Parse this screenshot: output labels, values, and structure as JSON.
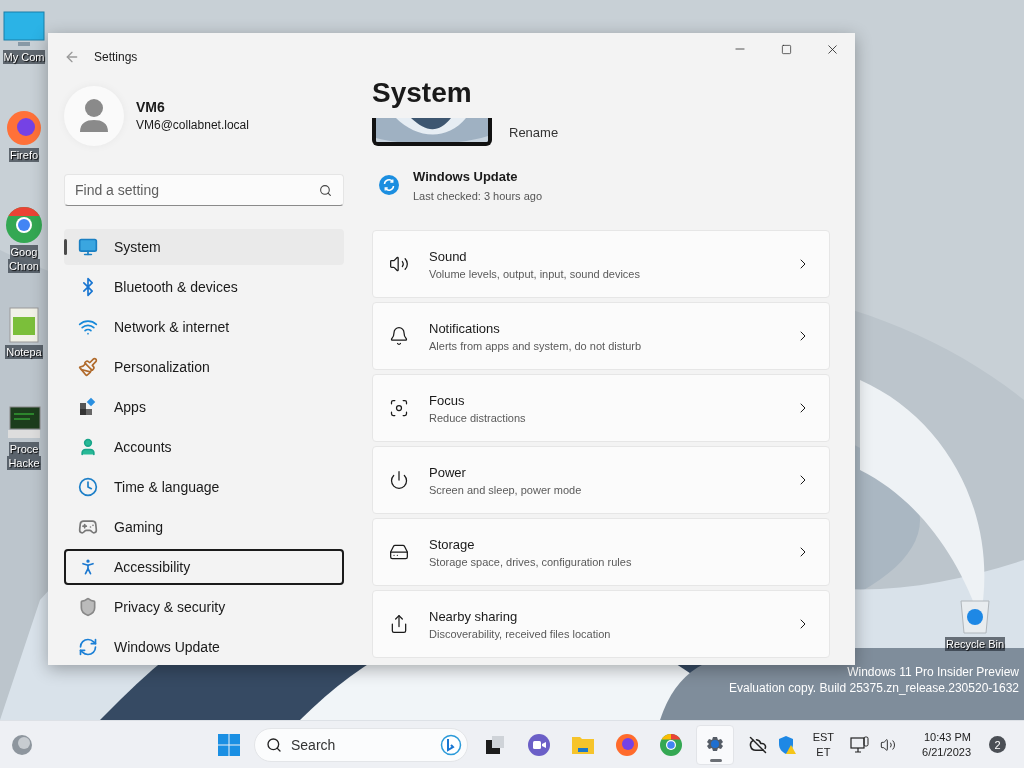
{
  "desktop_icons": [
    {
      "lines": [
        "My Com"
      ]
    },
    {
      "lines": [
        "Firefo"
      ]
    },
    {
      "lines": [
        "Goog",
        "Chron"
      ]
    },
    {
      "lines": [
        "Notepa"
      ]
    },
    {
      "lines": [
        "Proce",
        "Hacke"
      ]
    }
  ],
  "recycle_bin": {
    "label": "Recycle Bin"
  },
  "watermark": [
    "Windows 11 Pro Insider Preview",
    "Evaluation copy. Build 25375.zn_release.230520-1632"
  ],
  "settings_window": {
    "title": "Settings",
    "account": {
      "name": "VM6",
      "email": "VM6@collabnet.local"
    },
    "search": {
      "placeholder": "Find a setting"
    },
    "nav": [
      {
        "label": "System",
        "selected": true,
        "focused": false
      },
      {
        "label": "Bluetooth & devices",
        "selected": false,
        "focused": false
      },
      {
        "label": "Network & internet",
        "selected": false,
        "focused": false
      },
      {
        "label": "Personalization",
        "selected": false,
        "focused": false
      },
      {
        "label": "Apps",
        "selected": false,
        "focused": false
      },
      {
        "label": "Accounts",
        "selected": false,
        "focused": false
      },
      {
        "label": "Time & language",
        "selected": false,
        "focused": false
      },
      {
        "label": "Gaming",
        "selected": false,
        "focused": false
      },
      {
        "label": "Accessibility",
        "selected": false,
        "focused": true
      },
      {
        "label": "Privacy & security",
        "selected": false,
        "focused": false
      },
      {
        "label": "Windows Update",
        "selected": false,
        "focused": false
      }
    ],
    "page_title": "System",
    "device": {
      "rename": "Rename"
    },
    "update": {
      "title": "Windows Update",
      "status": "Last checked: 3 hours ago"
    },
    "cards": [
      {
        "title": "Sound",
        "subtitle": "Volume levels, output, input, sound devices"
      },
      {
        "title": "Notifications",
        "subtitle": "Alerts from apps and system, do not disturb"
      },
      {
        "title": "Focus",
        "subtitle": "Reduce distractions"
      },
      {
        "title": "Power",
        "subtitle": "Screen and sleep, power mode"
      },
      {
        "title": "Storage",
        "subtitle": "Storage space, drives, configuration rules"
      },
      {
        "title": "Nearby sharing",
        "subtitle": "Discoverability, received files location"
      }
    ]
  },
  "taskbar": {
    "search": {
      "placeholder": "Search"
    },
    "apps": [
      {
        "selected": false
      },
      {
        "selected": false
      },
      {
        "selected": false
      },
      {
        "selected": false
      },
      {
        "selected": false
      },
      {
        "selected": true
      }
    ],
    "tray": {
      "timezone": [
        "EST",
        "ET"
      ],
      "time": "10:43 PM",
      "date": "6/21/2023",
      "notifications": "2"
    }
  }
}
